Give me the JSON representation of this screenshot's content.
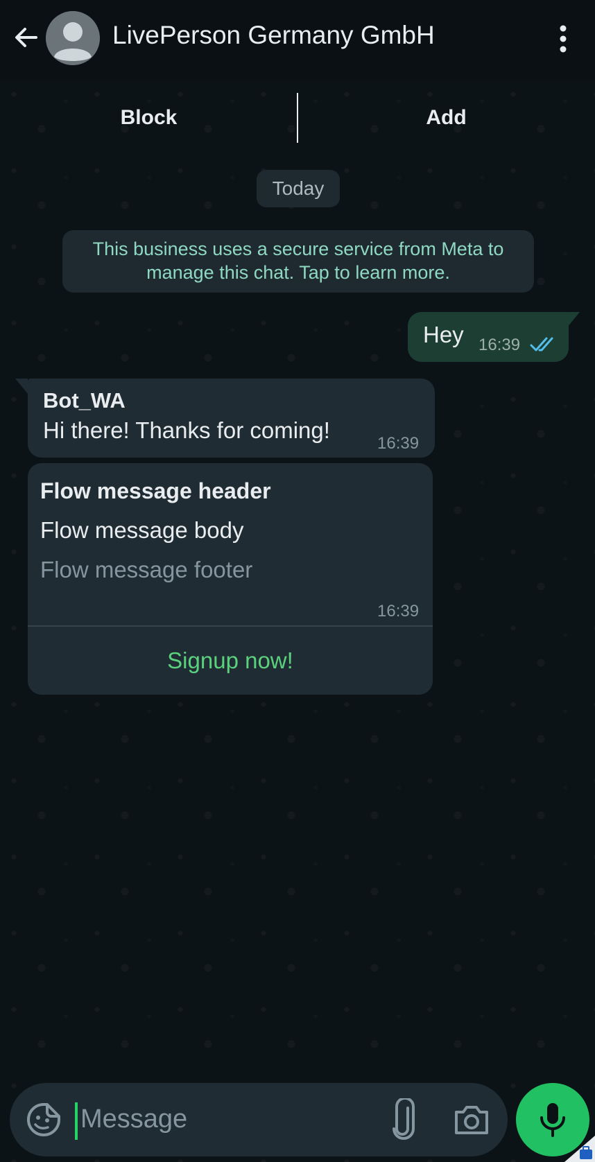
{
  "header": {
    "title": "LivePerson Germany GmbH",
    "back_icon": "arrow-left-icon",
    "avatar_icon": "default-avatar-icon",
    "menu_icon": "more-vertical-icon"
  },
  "actions": {
    "block_label": "Block",
    "add_label": "Add"
  },
  "chat": {
    "date_label": "Today",
    "notice": "This business uses a secure service from Meta to manage this chat. Tap to learn more.",
    "messages": [
      {
        "direction": "outgoing",
        "text": "Hey",
        "time": "16:39",
        "status": "read"
      },
      {
        "direction": "incoming",
        "sender": "Bot_WA",
        "text": "Hi there! Thanks for coming!",
        "time": "16:39"
      },
      {
        "direction": "incoming",
        "type": "flow",
        "header": "Flow message header",
        "body": "Flow message body",
        "footer": "Flow message footer",
        "time": "16:39",
        "cta": "Signup now!"
      }
    ]
  },
  "composer": {
    "placeholder": "Message",
    "emoji_icon": "sticker-emoji-icon",
    "attach_icon": "paperclip-icon",
    "camera_icon": "camera-icon",
    "mic_icon": "microphone-icon"
  },
  "colors": {
    "accent_green": "#21c063",
    "outgoing_bubble": "#1d3f33",
    "incoming_bubble": "#202c33",
    "cta_text": "#5bd17e",
    "read_ticks": "#53bdeb"
  }
}
